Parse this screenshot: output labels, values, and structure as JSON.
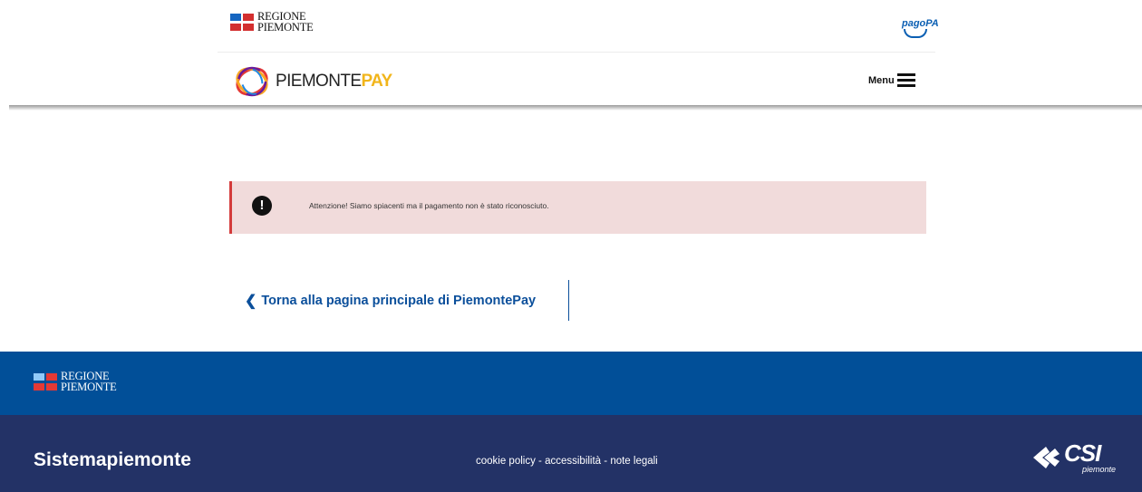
{
  "header": {
    "region_logo": {
      "line1": "REGIONE",
      "line2": "PIEMONTE"
    },
    "pagopa": {
      "label": "pagoPA"
    },
    "app_logo": {
      "name_part1": "PIEMONTE",
      "name_part2": "PAY"
    },
    "menu_label": "Menu"
  },
  "alert": {
    "icon": "exclamation-circle-icon",
    "message": "Attenzione! Siamo spiacenti ma il pagamento non è stato riconosciuto.",
    "colors": {
      "background": "#f1dbdb",
      "border": "#d43b3b"
    }
  },
  "back_link": {
    "label": "Torna alla pagina principale di PiemontePay"
  },
  "footer": {
    "region_logo": {
      "line1": "REGIONE",
      "line2": "PIEMONTE"
    },
    "brand": "Sistemapiemonte",
    "links": [
      {
        "label": "cookie policy"
      },
      {
        "label": "accessibilità"
      },
      {
        "label": "note legali"
      }
    ],
    "separator": " - ",
    "csi_logo": {
      "main": "CSI",
      "sub": "piemonte"
    },
    "colors": {
      "top": "#014f98",
      "bottom": "#233266"
    }
  }
}
